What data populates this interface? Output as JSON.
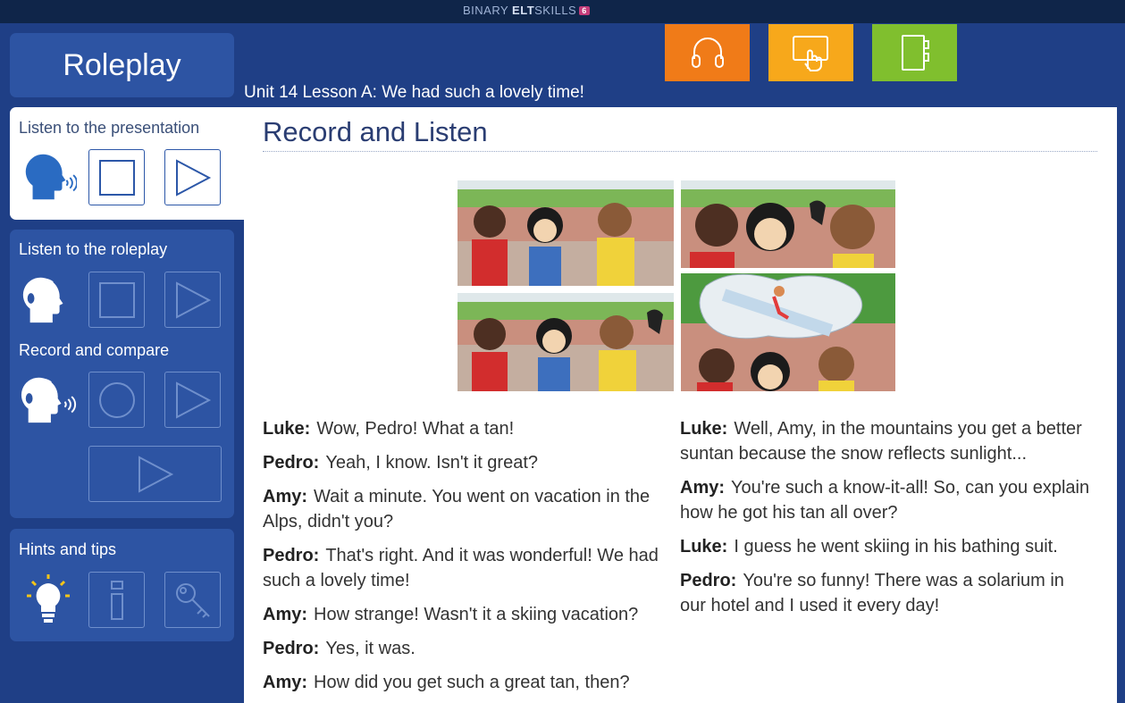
{
  "app": {
    "brand_prefix": "BINARY ",
    "brand_bold": "ELT",
    "brand_suffix": "SKILLS",
    "brand_badge": "6"
  },
  "header": {
    "section_title": "Roleplay",
    "lesson_title": "Unit 14 Lesson A: We had such a lovely time!"
  },
  "toolbar": [
    {
      "icon": "headphones-icon",
      "color": "#f07b18"
    },
    {
      "icon": "touch-hand-icon",
      "color": "#f7a81b"
    },
    {
      "icon": "notebook-icon",
      "color": "#80bf2e"
    }
  ],
  "sidebar": {
    "presentation": {
      "label": "Listen to the presentation",
      "icons": [
        "speaking-head-icon",
        "stop-icon",
        "play-icon"
      ]
    },
    "roleplay": {
      "label": "Listen to the roleplay",
      "icons": [
        "headset-head-icon",
        "stop-icon",
        "play-icon"
      ]
    },
    "record": {
      "label": "Record and compare",
      "icons": [
        "headset-speaking-icon",
        "record-icon",
        "play-icon",
        "play-compare-icon"
      ]
    },
    "hints": {
      "label": "Hints and tips",
      "icons": [
        "lightbulb-icon",
        "info-icon",
        "key-icon"
      ]
    }
  },
  "main": {
    "title": "Record and Listen",
    "dialog_col1": [
      {
        "speaker": "Luke:",
        "text": "Wow, Pedro! What a tan!"
      },
      {
        "speaker": "Pedro:",
        "text": "Yeah, I know. Isn't it great?"
      },
      {
        "speaker": "Amy:",
        "text": "Wait a minute. You went on vacation in the Alps, didn't you?"
      },
      {
        "speaker": "Pedro:",
        "text": "That's right. And it was wonderful! We had such a lovely time!"
      },
      {
        "speaker": "Amy:",
        "text": "How strange! Wasn't it a skiing vacation?"
      },
      {
        "speaker": "Pedro:",
        "text": "Yes, it was."
      },
      {
        "speaker": "Amy:",
        "text": "How did you get such a great tan, then?"
      }
    ],
    "dialog_col2": [
      {
        "speaker": "Luke:",
        "text": "Well, Amy, in the mountains you get a better suntan because the snow reflects sunlight..."
      },
      {
        "speaker": "Amy:",
        "text": "You're such a know-it-all! So, can you explain how he got his tan all over?"
      },
      {
        "speaker": "Luke:",
        "text": "I guess he went skiing in his bathing suit."
      },
      {
        "speaker": "Pedro:",
        "text": "You're so funny! There was a solarium in our hotel and I used it every day!"
      }
    ]
  },
  "colors": {
    "background": "#1f3f86",
    "panel": "#2d54a3",
    "topbar": "#0f2549",
    "title_text": "#2a3d72"
  }
}
